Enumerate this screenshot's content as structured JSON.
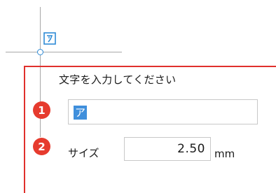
{
  "prompt": "文字を入力してください",
  "steps": {
    "one": "1",
    "two": "2"
  },
  "text_field": {
    "value": "ア"
  },
  "size_field": {
    "label": "サイズ",
    "value": "2.50",
    "unit": "mm"
  },
  "colors": {
    "accent_red": "#e0302c",
    "badge_red": "#e63b2e",
    "selection_blue": "#3f8fdc",
    "origin_blue": "#2e8bd6"
  }
}
